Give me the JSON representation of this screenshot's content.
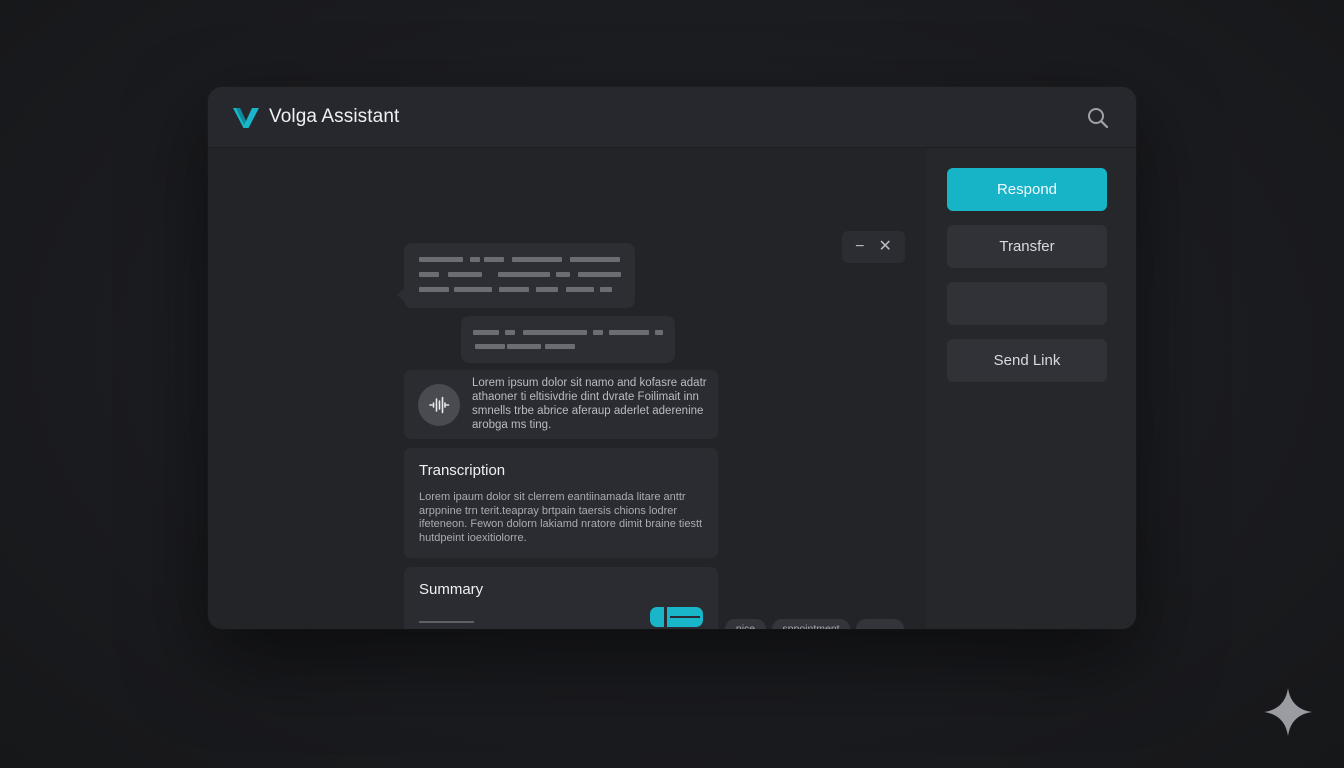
{
  "app": {
    "title": "Volga Assistant",
    "accent_color": "#17b3c6",
    "logo_icon": "v-logo-icon"
  },
  "header": {
    "search_icon": "search-icon"
  },
  "window_controls": {
    "minimize_label": "−",
    "close_label": "✕"
  },
  "chat": {
    "audio_message": {
      "icon": "waveform-icon",
      "text": "Lorem ipsum dolor sit namo and kofasre adatr athaoner ti eltisivdrie dint dvrate Foilimait inn smnells trbe abrice aferaup aderlet aderenine arobga ms ting."
    }
  },
  "transcription": {
    "title": "Transcription",
    "body": "Lorem ipaum dolor sit clerrem eantiinamada litare anttr arppnine trn terit.teapray brtpain taersis chions lodrer ifeteneon. Fewon dolorn lakiamd nratore dimit braine tiestt hutdpeint ioexitiolorre."
  },
  "summary": {
    "title": "Summary"
  },
  "tags": [
    "pice",
    "sppointment",
    ""
  ],
  "actions": {
    "respond": "Respond",
    "transfer": "Transfer",
    "empty": "",
    "send_link": "Send Link"
  }
}
